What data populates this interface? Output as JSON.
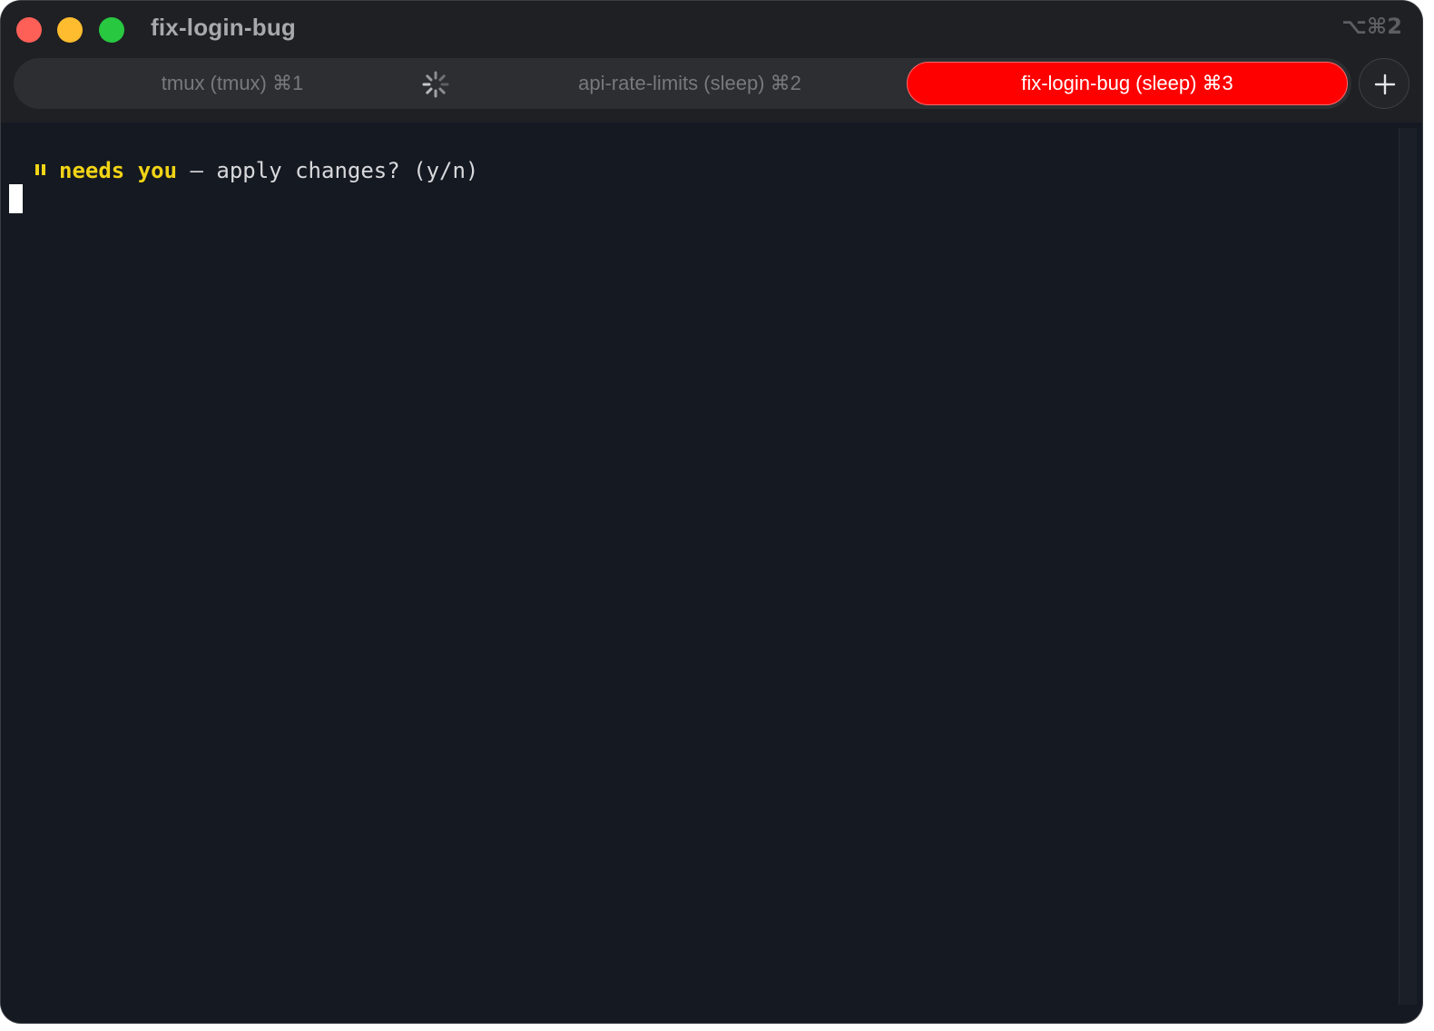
{
  "window": {
    "title": "fix-login-bug",
    "shortcut_hint": "⌥⌘2"
  },
  "tabs": [
    {
      "label": "tmux (tmux) ⌘1",
      "active": false
    },
    {
      "label": "api-rate-limits (sleep) ⌘2",
      "active": false,
      "busy": true
    },
    {
      "label": "fix-login-bug (sleep) ⌘3",
      "active": true
    }
  ],
  "icons": {
    "spinner": "spinner-icon",
    "new_tab": "plus-icon",
    "status": "pause-icon"
  },
  "terminal": {
    "status_word": "needs you",
    "prompt_rest": " — apply changes? (y/n)"
  },
  "colors": {
    "active_tab": "#ff0000",
    "status_highlight": "#f1d416",
    "terminal_bg": "#151921",
    "titlebar_bg": "#1f2024"
  }
}
